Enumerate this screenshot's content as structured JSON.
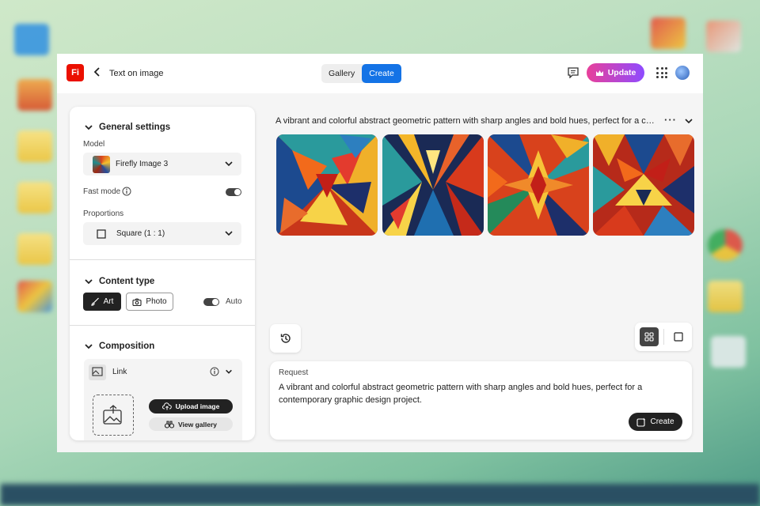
{
  "header": {
    "logo_text": "Fi",
    "back_icon": "chevron-left-icon",
    "page_title": "Text on image",
    "tabs": [
      {
        "label": "Gallery",
        "active": false
      },
      {
        "label": "Create",
        "active": true
      }
    ],
    "update_label": "Update",
    "accent": "#1473e6"
  },
  "settings": {
    "general": {
      "heading": "General settings",
      "model_label": "Model",
      "model_value": "Firefly Image 3",
      "fast_mode_label": "Fast mode",
      "fast_mode_on": true,
      "proportions_label": "Proportions",
      "proportions_value": "Square (1 : 1)"
    },
    "content_type": {
      "heading": "Content type",
      "art_label": "Art",
      "photo_label": "Photo",
      "selected": "Art",
      "auto_label": "Auto",
      "auto_on": true
    },
    "composition": {
      "heading": "Composition",
      "link_label": "Link",
      "upload_label": "Upload image",
      "view_gallery_label": "View gallery"
    }
  },
  "results": {
    "prompt_summary": "A vibrant and colorful abstract geometric pattern with sharp angles and bold hues, perfect for a con...",
    "image_count": 4
  },
  "request": {
    "label": "Request",
    "text": "A vibrant and colorful abstract geometric pattern with sharp angles and bold hues, perfect for a contemporary graphic design project.",
    "create_label": "Create"
  }
}
